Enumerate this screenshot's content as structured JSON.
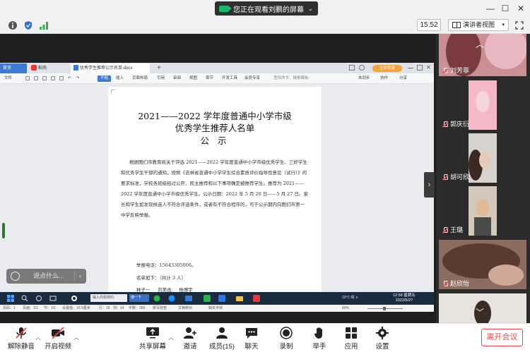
{
  "top_bar": {
    "share_status": "您正在观看刘鹏的屏幕",
    "window_controls": [
      "minimize",
      "maximize",
      "close"
    ]
  },
  "info_bar": {
    "timer": "15:52",
    "view_mode": "演讲者视图"
  },
  "shared_screen": {
    "browser_tabs": [
      "首页",
      "稻壳",
      "优秀学生推荐公示名单.docx"
    ],
    "login_label": "立即登录",
    "ribbon_tabs": [
      "文件",
      "开始",
      "插入",
      "页面布局",
      "引用",
      "审阅",
      "视图",
      "章节",
      "开发工具",
      "会员专享"
    ],
    "ribbon_search": "查找命令、搜索模板",
    "ribbon_right": [
      "未同步",
      "协作",
      "分享"
    ],
    "document": {
      "title_line1": "2021——2022 学年度普通中小学市级",
      "title_line2": "优秀学生推荐人名单",
      "title_line3": "公 示",
      "body": "根据图们市教育局关于评选 2021——2022 学年度普通中小学市级优秀学生、三好学生和优秀学生干部的通知，按照《吉林省普通中小学学生综合素质评价指导性意见（试行）》的要求标准，学校各班级经过公开、民主推荐和以下事项确定被推荐学生。推荐为 2021——2022 学年度普通中小学市级优秀学生。公示日期：2022 年 5 月 20 日——5 月 27 日。",
      "body2": "家长和学生如发现候选人不符合评选条件，或者有不符合程序的，可于公示期内向图们市第一中学反映举报。",
      "phone": "举报电话：15643305006。",
      "namelist_intro": "名单如下：（共计 3 人）",
      "names": "林子一 　 刘美函 　 杨博宇"
    },
    "status_bar": {
      "page_num": "页码：1",
      "pages": "页面：1/1",
      "section": "节：1/1",
      "setting_value": "设置值：19.5厘米",
      "row": "行：16",
      "column": "列：14",
      "word_count": "字数：265",
      "spell_check": "拼写检查",
      "doc_proofread": "文档校对",
      "missing_fonts": "缺失字体",
      "zoom": "80%"
    },
    "taskbar": {
      "search_placeholder": "输入你想搜的",
      "input_method": "搜一下",
      "weather": "33°C 晴 ∧",
      "time": "12:58 星期五",
      "date": "2022/5/27"
    }
  },
  "chat": {
    "placeholder": "说点什么..."
  },
  "participants": [
    {
      "name": "刘芳菲",
      "muted": true
    },
    {
      "name": "郭庆衍",
      "muted": true
    },
    {
      "name": "胡可欣",
      "muted": true
    },
    {
      "name": "王璐",
      "muted": true
    },
    {
      "name": "赵欣怡",
      "muted": true
    }
  ],
  "toolbar": {
    "unmute": "解除静音",
    "start_video": "开启视频",
    "share_screen": "共享屏幕",
    "invite": "邀请",
    "members": "成员(15)",
    "chat": "聊天",
    "record": "录制",
    "raise_hand": "举手",
    "apps": "应用",
    "settings": "设置",
    "leave": "离开会议"
  },
  "colors": {
    "accent_blue": "#3b79d8",
    "leave_red": "#e34a4a",
    "share_green": "#18b86b",
    "panel_dark": "#2b2b2b"
  }
}
